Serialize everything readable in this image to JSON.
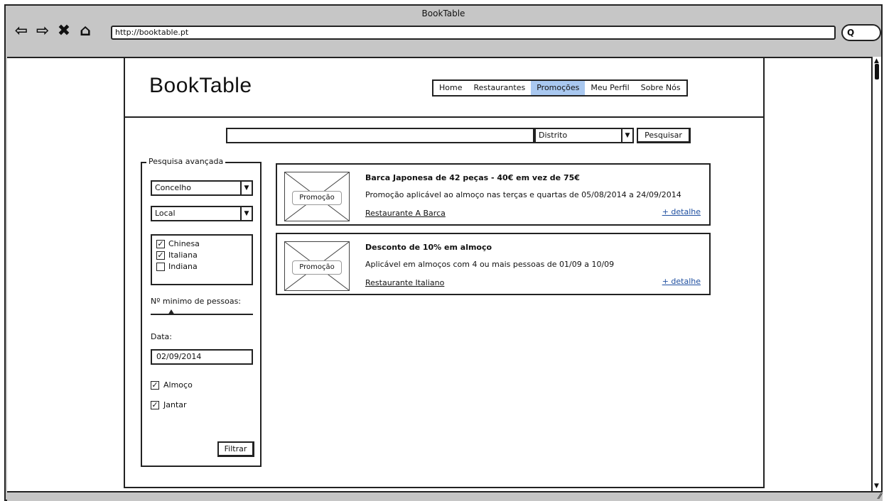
{
  "window": {
    "title": "BookTable",
    "url": "http://booktable.pt",
    "search_glyph": "Q"
  },
  "header": {
    "logo": "BookTable",
    "menu": [
      {
        "label": "Home",
        "active": false
      },
      {
        "label": "Restaurantes",
        "active": false
      },
      {
        "label": "Promoções",
        "active": true
      },
      {
        "label": "Meu Perfil",
        "active": false
      },
      {
        "label": "Sobre Nós",
        "active": false
      }
    ]
  },
  "search": {
    "query": "",
    "district_selected": "Distrito",
    "button_label": "Pesquisar"
  },
  "advanced": {
    "legend": "Pesquisa avançada",
    "concelho": "Concelho",
    "local": "Local",
    "cuisines": [
      {
        "label": "Chinesa",
        "checked": true
      },
      {
        "label": "Italiana",
        "checked": true
      },
      {
        "label": "Indiana",
        "checked": false
      }
    ],
    "min_people_label": "Nº minimo de pessoas:",
    "min_people_level": 0.2,
    "date_label": "Data:",
    "date_value": "02/09/2014",
    "meals": [
      {
        "label": "Almoço",
        "checked": true
      },
      {
        "label": "Jantar",
        "checked": true
      }
    ],
    "filter_label": "Filtrar"
  },
  "promotions": [
    {
      "image_label": "Promoção",
      "title": "Barca Japonesa de 42 peças - 40€ em vez de 75€",
      "description": "Promoção aplicável ao almoço nas terças e quartas de 05/08/2014 a 24/09/2014",
      "restaurant": "Restaurante A Barca",
      "details": "+ detalhe"
    },
    {
      "image_label": "Promoção",
      "title": "Desconto de 10% em almoço",
      "description": "Aplicável em almoços com 4 ou mais pessoas de 01/09 a 10/09",
      "restaurant": "Restaurante Italiano",
      "details": "+ detalhe"
    }
  ],
  "icons": {
    "back": "back-arrow-icon",
    "forward": "forward-arrow-icon",
    "stop": "close-icon",
    "home": "home-icon",
    "dropdown": "chevron-down-icon",
    "checkbox": "checkbox-icon"
  }
}
